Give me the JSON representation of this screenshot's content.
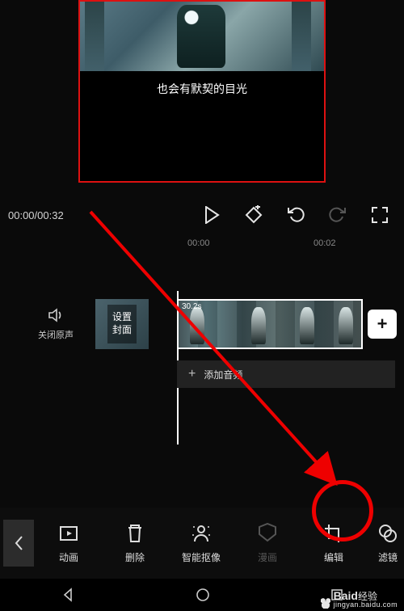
{
  "preview": {
    "subtitle": "也会有默契的目光"
  },
  "playback": {
    "timecode": "00:00/00:32"
  },
  "ruler": {
    "t0": "00:00",
    "t1": "00:02"
  },
  "mute_label": "关闭原声",
  "cover_label": "设置\n封面",
  "clip_duration": "30.2s",
  "add_audio_label": "添加音频",
  "toolbar": {
    "animation": "动画",
    "delete": "删除",
    "cutout": "智能抠像",
    "comic": "漫画",
    "edit": "编辑",
    "filter": "滤镜"
  },
  "watermark": {
    "brand": "Baid",
    "suffix": "经验",
    "url": "jingyan.baidu.com"
  }
}
